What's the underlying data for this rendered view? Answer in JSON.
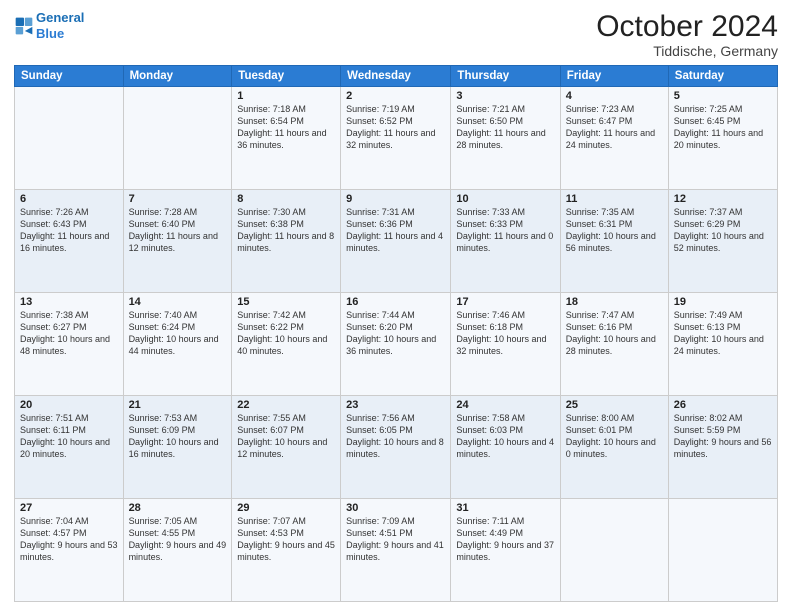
{
  "header": {
    "logo_line1": "General",
    "logo_line2": "Blue",
    "month": "October 2024",
    "location": "Tiddische, Germany"
  },
  "weekdays": [
    "Sunday",
    "Monday",
    "Tuesday",
    "Wednesday",
    "Thursday",
    "Friday",
    "Saturday"
  ],
  "weeks": [
    [
      {
        "day": "",
        "info": ""
      },
      {
        "day": "",
        "info": ""
      },
      {
        "day": "1",
        "info": "Sunrise: 7:18 AM\nSunset: 6:54 PM\nDaylight: 11 hours and 36 minutes."
      },
      {
        "day": "2",
        "info": "Sunrise: 7:19 AM\nSunset: 6:52 PM\nDaylight: 11 hours and 32 minutes."
      },
      {
        "day": "3",
        "info": "Sunrise: 7:21 AM\nSunset: 6:50 PM\nDaylight: 11 hours and 28 minutes."
      },
      {
        "day": "4",
        "info": "Sunrise: 7:23 AM\nSunset: 6:47 PM\nDaylight: 11 hours and 24 minutes."
      },
      {
        "day": "5",
        "info": "Sunrise: 7:25 AM\nSunset: 6:45 PM\nDaylight: 11 hours and 20 minutes."
      }
    ],
    [
      {
        "day": "6",
        "info": "Sunrise: 7:26 AM\nSunset: 6:43 PM\nDaylight: 11 hours and 16 minutes."
      },
      {
        "day": "7",
        "info": "Sunrise: 7:28 AM\nSunset: 6:40 PM\nDaylight: 11 hours and 12 minutes."
      },
      {
        "day": "8",
        "info": "Sunrise: 7:30 AM\nSunset: 6:38 PM\nDaylight: 11 hours and 8 minutes."
      },
      {
        "day": "9",
        "info": "Sunrise: 7:31 AM\nSunset: 6:36 PM\nDaylight: 11 hours and 4 minutes."
      },
      {
        "day": "10",
        "info": "Sunrise: 7:33 AM\nSunset: 6:33 PM\nDaylight: 11 hours and 0 minutes."
      },
      {
        "day": "11",
        "info": "Sunrise: 7:35 AM\nSunset: 6:31 PM\nDaylight: 10 hours and 56 minutes."
      },
      {
        "day": "12",
        "info": "Sunrise: 7:37 AM\nSunset: 6:29 PM\nDaylight: 10 hours and 52 minutes."
      }
    ],
    [
      {
        "day": "13",
        "info": "Sunrise: 7:38 AM\nSunset: 6:27 PM\nDaylight: 10 hours and 48 minutes."
      },
      {
        "day": "14",
        "info": "Sunrise: 7:40 AM\nSunset: 6:24 PM\nDaylight: 10 hours and 44 minutes."
      },
      {
        "day": "15",
        "info": "Sunrise: 7:42 AM\nSunset: 6:22 PM\nDaylight: 10 hours and 40 minutes."
      },
      {
        "day": "16",
        "info": "Sunrise: 7:44 AM\nSunset: 6:20 PM\nDaylight: 10 hours and 36 minutes."
      },
      {
        "day": "17",
        "info": "Sunrise: 7:46 AM\nSunset: 6:18 PM\nDaylight: 10 hours and 32 minutes."
      },
      {
        "day": "18",
        "info": "Sunrise: 7:47 AM\nSunset: 6:16 PM\nDaylight: 10 hours and 28 minutes."
      },
      {
        "day": "19",
        "info": "Sunrise: 7:49 AM\nSunset: 6:13 PM\nDaylight: 10 hours and 24 minutes."
      }
    ],
    [
      {
        "day": "20",
        "info": "Sunrise: 7:51 AM\nSunset: 6:11 PM\nDaylight: 10 hours and 20 minutes."
      },
      {
        "day": "21",
        "info": "Sunrise: 7:53 AM\nSunset: 6:09 PM\nDaylight: 10 hours and 16 minutes."
      },
      {
        "day": "22",
        "info": "Sunrise: 7:55 AM\nSunset: 6:07 PM\nDaylight: 10 hours and 12 minutes."
      },
      {
        "day": "23",
        "info": "Sunrise: 7:56 AM\nSunset: 6:05 PM\nDaylight: 10 hours and 8 minutes."
      },
      {
        "day": "24",
        "info": "Sunrise: 7:58 AM\nSunset: 6:03 PM\nDaylight: 10 hours and 4 minutes."
      },
      {
        "day": "25",
        "info": "Sunrise: 8:00 AM\nSunset: 6:01 PM\nDaylight: 10 hours and 0 minutes."
      },
      {
        "day": "26",
        "info": "Sunrise: 8:02 AM\nSunset: 5:59 PM\nDaylight: 9 hours and 56 minutes."
      }
    ],
    [
      {
        "day": "27",
        "info": "Sunrise: 7:04 AM\nSunset: 4:57 PM\nDaylight: 9 hours and 53 minutes."
      },
      {
        "day": "28",
        "info": "Sunrise: 7:05 AM\nSunset: 4:55 PM\nDaylight: 9 hours and 49 minutes."
      },
      {
        "day": "29",
        "info": "Sunrise: 7:07 AM\nSunset: 4:53 PM\nDaylight: 9 hours and 45 minutes."
      },
      {
        "day": "30",
        "info": "Sunrise: 7:09 AM\nSunset: 4:51 PM\nDaylight: 9 hours and 41 minutes."
      },
      {
        "day": "31",
        "info": "Sunrise: 7:11 AM\nSunset: 4:49 PM\nDaylight: 9 hours and 37 minutes."
      },
      {
        "day": "",
        "info": ""
      },
      {
        "day": "",
        "info": ""
      }
    ]
  ]
}
